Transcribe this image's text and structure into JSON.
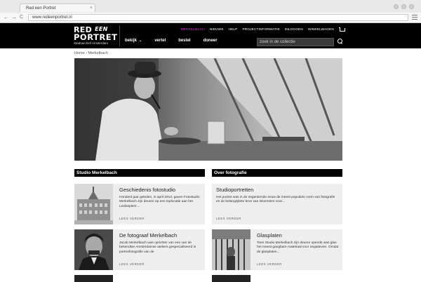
{
  "browser": {
    "tab_title": "Red een Portret",
    "tab_close": "×",
    "url": "www.redeenportret.nl",
    "back": "←",
    "forward": "→",
    "reload": "C"
  },
  "logo": {
    "red": "RED",
    "een": "EEN",
    "portret": "PORTRET",
    "sub": "Stadsarchief Amsterdam"
  },
  "topnav": {
    "items": [
      "MERKELBACH",
      "NIEUWS",
      "HELP",
      "PROJECTINFORMATIE",
      "INLOGGEN",
      "WINKELWAGEN"
    ],
    "active_color": "#d535d5"
  },
  "mainnav": {
    "items": [
      "bekijk",
      "vertel",
      "bestel",
      "doneer"
    ],
    "chevron": "⌄"
  },
  "search": {
    "placeholder": "zoek in de collectie"
  },
  "breadcrumb": "Home › Merkelbach",
  "sections": {
    "left": "Studio Merkelbach",
    "right": "Over fotografie"
  },
  "cards": [
    {
      "title": "Geschiedenis fotostudio",
      "text": "Honderd jaar geleden, in april 1913, gaven Fotostudio Merkelbach zijn deuren op een toplocatie aan het Leidseplein:...",
      "more": "LEES VERDER"
    },
    {
      "title": "Studioportretten",
      "text": "Het portret was in de negentiende eeuw de meest populaire vorm van fotografie en de belangrijkste bron van inkomsten voor...",
      "more": "LEES VERDER"
    },
    {
      "title": "De fotograaf Merkelbach",
      "text": "Jacob Merkelbach was oprichter van een van de bekendste Amsterdamse ateliers gespecialiseerd in portretfotografie van de",
      "more": "LEES VERDER"
    },
    {
      "title": "Glasplaten",
      "text": "Toen Studio Merkelbach zijn deuren opende was glas het meest gangbare materiaal voor negatieven. Omdat de glasplaten...",
      "more": "LEES VERDER"
    }
  ]
}
